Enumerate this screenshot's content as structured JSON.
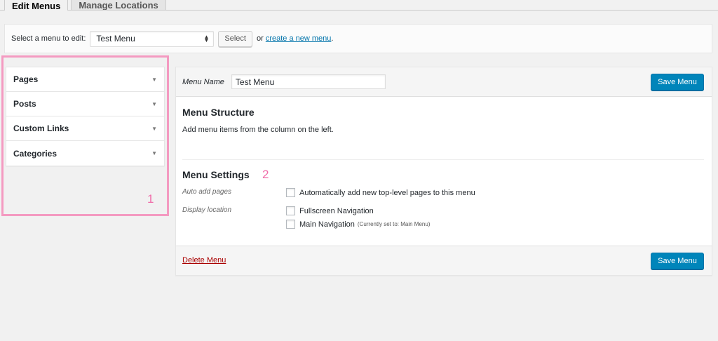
{
  "tabs": [
    {
      "label": "Edit Menus"
    },
    {
      "label": "Manage Locations"
    }
  ],
  "select_bar": {
    "label": "Select a menu to edit:",
    "selected_menu": "Test Menu",
    "select_button": "Select",
    "or_text": "or",
    "create_link": "create a new menu",
    "period": "."
  },
  "annotations": {
    "box1_number": "1",
    "box2_number": "2",
    "color": "#f49ac1"
  },
  "accordion": {
    "items": [
      {
        "label": "Pages"
      },
      {
        "label": "Posts"
      },
      {
        "label": "Custom Links"
      },
      {
        "label": "Categories"
      }
    ],
    "toggle_icon": "▼"
  },
  "panel": {
    "menu_name_label": "Menu Name",
    "menu_name_value": "Test Menu",
    "save_button": "Save Menu",
    "structure_title": "Menu Structure",
    "structure_help": "Add menu items from the column on the left.",
    "settings_title": "Menu Settings",
    "auto_add_label": "Auto add pages",
    "auto_add_option": "Automatically add new top-level pages to this menu",
    "display_location_label": "Display location",
    "locations": [
      {
        "label": "Fullscreen Navigation",
        "note": ""
      },
      {
        "label": "Main Navigation",
        "note": "(Currently set to: Main Menu)"
      }
    ],
    "delete_link": "Delete Menu"
  },
  "colors": {
    "primary": "#0085ba",
    "link": "#0073aa",
    "delete": "#a00000",
    "annotation": "#f06ba8"
  }
}
